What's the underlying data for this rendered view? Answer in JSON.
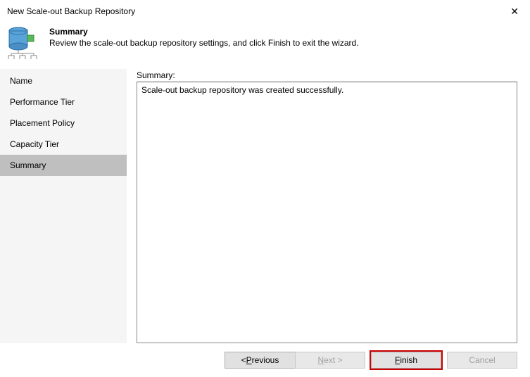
{
  "window": {
    "title": "New Scale-out Backup Repository"
  },
  "header": {
    "title": "Summary",
    "subtitle": "Review the scale-out backup repository settings, and click Finish to exit the wizard."
  },
  "sidebar": {
    "items": [
      {
        "label": "Name",
        "selected": false
      },
      {
        "label": "Performance Tier",
        "selected": false
      },
      {
        "label": "Placement Policy",
        "selected": false
      },
      {
        "label": "Capacity Tier",
        "selected": false
      },
      {
        "label": "Summary",
        "selected": true
      }
    ]
  },
  "main": {
    "summary_label": "Summary:",
    "summary_text": "Scale-out backup repository was created successfully."
  },
  "footer": {
    "previous": {
      "prefix": "< ",
      "mnemonic": "P",
      "rest": "revious"
    },
    "next": {
      "mnemonic": "N",
      "rest": "ext >"
    },
    "finish": {
      "mnemonic": "F",
      "rest": "inish"
    },
    "cancel": {
      "label": "Cancel"
    }
  }
}
